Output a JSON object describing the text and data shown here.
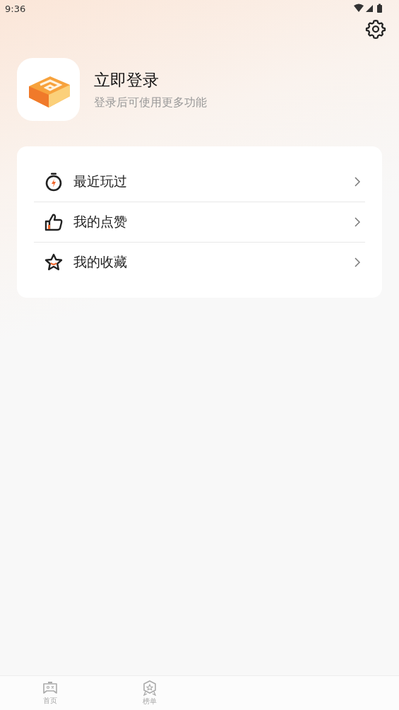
{
  "status_bar": {
    "time": "9:36"
  },
  "profile": {
    "title": "立即登录",
    "subtitle": "登录后可使用更多功能"
  },
  "menu": [
    {
      "kind": "recent",
      "label": "最近玩过"
    },
    {
      "kind": "likes",
      "label": "我的点赞"
    },
    {
      "kind": "favorites",
      "label": "我的收藏"
    }
  ],
  "bottom_nav": [
    {
      "kind": "home",
      "label": "首页",
      "selected": false
    },
    {
      "kind": "ranking",
      "label": "榜单",
      "selected": false
    }
  ]
}
